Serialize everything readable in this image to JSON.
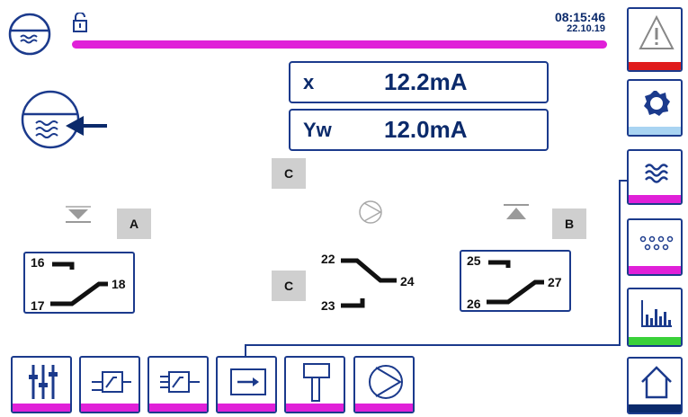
{
  "header": {
    "time": "08:15:46",
    "date": "22.10.19",
    "progress_fraction": 1.0,
    "progress_color": "#e020d8"
  },
  "readings": [
    {
      "label": "x",
      "value": "12.2mA"
    },
    {
      "label": "Yw",
      "value": "12.0mA"
    }
  ],
  "tags": {
    "c_top": "C",
    "a": "A",
    "b": "B",
    "c_mid": "C"
  },
  "contacts": {
    "left": {
      "top": "16",
      "right": "18",
      "bottom": "17"
    },
    "mid": {
      "top": "22",
      "right": "24",
      "bottom": "23"
    },
    "right": {
      "top": "25",
      "right": "27",
      "bottom": "26"
    }
  },
  "side_buttons": [
    {
      "icon": "warning-icon",
      "stripe": "#e01b1b"
    },
    {
      "icon": "gear-icon",
      "stripe": "#a9d4f2"
    },
    {
      "icon": "waves-icon",
      "stripe": "#e020d8"
    },
    {
      "icon": "dots-icon",
      "stripe": "#e020d8"
    },
    {
      "icon": "bar-chart-icon",
      "stripe": "#3ad13a"
    },
    {
      "icon": "home-icon",
      "stripe": "#0b2a6b"
    }
  ],
  "bottom_buttons": [
    {
      "icon": "sliders-icon",
      "stripe": "#e020d8"
    },
    {
      "icon": "input-module-icon",
      "stripe": "#e020d8"
    },
    {
      "icon": "output-module-icon",
      "stripe": "#e020d8"
    },
    {
      "icon": "arrow-in-box-icon",
      "stripe": "#e020d8"
    },
    {
      "icon": "valve-icon",
      "stripe": "#e020d8"
    },
    {
      "icon": "pump-icon",
      "stripe": "#e020d8"
    }
  ],
  "colors": {
    "accent": "#1b3a8c",
    "magenta": "#e020d8",
    "tag_gray": "#cfcfcf"
  }
}
